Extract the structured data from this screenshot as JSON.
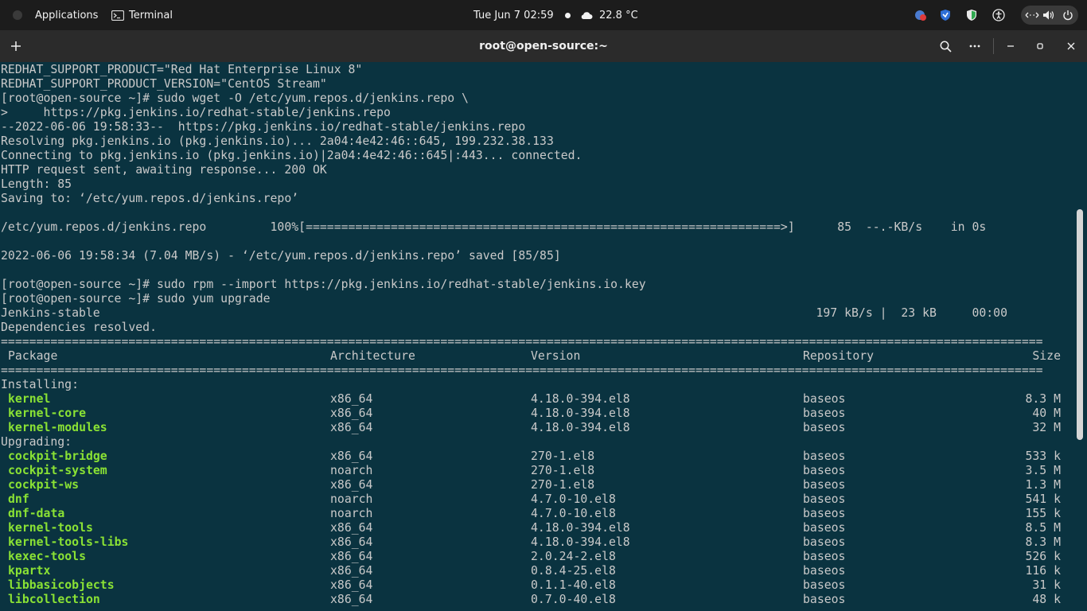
{
  "topbar": {
    "applications": "Applications",
    "terminal_label": "Terminal",
    "datetime": "Tue Jun 7  02:59",
    "weather": "22.8 °C"
  },
  "header": {
    "title": "root@open-source:~"
  },
  "terminal": {
    "lines": [
      "REDHAT_SUPPORT_PRODUCT=\"Red Hat Enterprise Linux 8\"",
      "REDHAT_SUPPORT_PRODUCT_VERSION=\"CentOS Stream\"",
      "[root@open-source ~]# sudo wget -O /etc/yum.repos.d/jenkins.repo \\",
      ">     https://pkg.jenkins.io/redhat-stable/jenkins.repo",
      "--2022-06-06 19:58:33--  https://pkg.jenkins.io/redhat-stable/jenkins.repo",
      "Resolving pkg.jenkins.io (pkg.jenkins.io)... 2a04:4e42:46::645, 199.232.38.133",
      "Connecting to pkg.jenkins.io (pkg.jenkins.io)|2a04:4e42:46::645|:443... connected.",
      "HTTP request sent, awaiting response... 200 OK",
      "Length: 85",
      "Saving to: ‘/etc/yum.repos.d/jenkins.repo’",
      "",
      "/etc/yum.repos.d/jenkins.repo         100%[===================================================================>]      85  --.-KB/s    in 0s",
      "",
      "2022-06-06 19:58:34 (7.04 MB/s) - ‘/etc/yum.repos.d/jenkins.repo’ saved [85/85]",
      "",
      "[root@open-source ~]# sudo rpm --import https://pkg.jenkins.io/redhat-stable/jenkins.io.key",
      "[root@open-source ~]# sudo yum upgrade",
      "Jenkins-stable                                                                                                     197 kB/s |  23 kB     00:00",
      "Dependencies resolved.",
      "===================================================================================================================================================",
      "",
      "==================================================================================================================================================="
    ],
    "table_header": {
      "package": "Package",
      "architecture": "Architecture",
      "version": "Version",
      "repository": "Repository",
      "size": "Size"
    },
    "sections": {
      "installing": "Installing:",
      "upgrading": "Upgrading:"
    },
    "installing": [
      {
        "name": "kernel",
        "arch": "x86_64",
        "version": "4.18.0-394.el8",
        "repo": "baseos",
        "size": "8.3 M"
      },
      {
        "name": "kernel-core",
        "arch": "x86_64",
        "version": "4.18.0-394.el8",
        "repo": "baseos",
        "size": "40 M"
      },
      {
        "name": "kernel-modules",
        "arch": "x86_64",
        "version": "4.18.0-394.el8",
        "repo": "baseos",
        "size": "32 M"
      }
    ],
    "upgrading": [
      {
        "name": "cockpit-bridge",
        "arch": "x86_64",
        "version": "270-1.el8",
        "repo": "baseos",
        "size": "533 k"
      },
      {
        "name": "cockpit-system",
        "arch": "noarch",
        "version": "270-1.el8",
        "repo": "baseos",
        "size": "3.5 M"
      },
      {
        "name": "cockpit-ws",
        "arch": "x86_64",
        "version": "270-1.el8",
        "repo": "baseos",
        "size": "1.3 M"
      },
      {
        "name": "dnf",
        "arch": "noarch",
        "version": "4.7.0-10.el8",
        "repo": "baseos",
        "size": "541 k"
      },
      {
        "name": "dnf-data",
        "arch": "noarch",
        "version": "4.7.0-10.el8",
        "repo": "baseos",
        "size": "155 k"
      },
      {
        "name": "kernel-tools",
        "arch": "x86_64",
        "version": "4.18.0-394.el8",
        "repo": "baseos",
        "size": "8.5 M"
      },
      {
        "name": "kernel-tools-libs",
        "arch": "x86_64",
        "version": "4.18.0-394.el8",
        "repo": "baseos",
        "size": "8.3 M"
      },
      {
        "name": "kexec-tools",
        "arch": "x86_64",
        "version": "2.0.24-2.el8",
        "repo": "baseos",
        "size": "526 k"
      },
      {
        "name": "kpartx",
        "arch": "x86_64",
        "version": "0.8.4-25.el8",
        "repo": "baseos",
        "size": "116 k"
      },
      {
        "name": "libbasicobjects",
        "arch": "x86_64",
        "version": "0.1.1-40.el8",
        "repo": "baseos",
        "size": "31 k"
      },
      {
        "name": "libcollection",
        "arch": "x86_64",
        "version": "0.7.0-40.el8",
        "repo": "baseos",
        "size": "48 k"
      }
    ]
  },
  "colors": {
    "terminal_bg": "#0a3340",
    "terminal_fg": "#c9c9c9",
    "package_green": "#8ae234",
    "header_bg": "#2b2b2b",
    "topbar_bg": "#1c1c1c"
  }
}
